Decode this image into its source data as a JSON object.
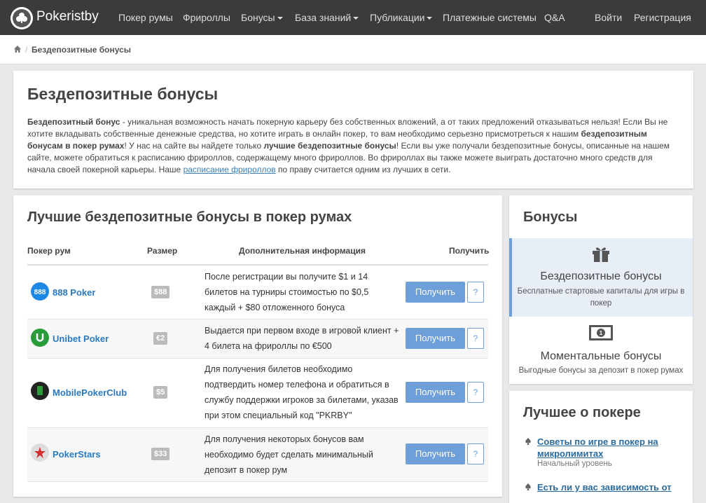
{
  "brand": {
    "name": "Pokeristby"
  },
  "nav": {
    "poker_rooms": "Покер румы",
    "freerolls": "Фрироллы",
    "bonuses": "Бонусы",
    "knowledge": "База знаний",
    "publications": "Публикации",
    "payments": "Платежные системы",
    "qa": "Q&A",
    "login": "Войти",
    "register": "Регистрация"
  },
  "breadcrumb": {
    "current": "Бездепозитные бонусы"
  },
  "intro": {
    "title": "Бездепозитные бонусы",
    "b1": "Бездепозитный бонус",
    "t1": " - уникальная возможность начать покерную карьеру без собственных вложений, а от таких предложений отказываться нельзя! Если Вы не хотите вкладывать собственные денежные средства, но хотите играть в онлайн покер, то вам необходимо серьезно присмотреться к нашим ",
    "b2": "бездепозитным бонусам в покер румах",
    "t2": "! У нас на сайте вы найдете только ",
    "b3": "лучшие бездепозитные бонусы",
    "t3": "! Если вы уже получали бездепозитные бонусы, описанные на нашем сайте, можете обратиться к расписанию фрироллов, содержащему много фрироллов. Во фрироллах вы также можете выиграть достаточно много средств для начала своей покерной карьеры. Наше ",
    "link": "расписание фрироллов",
    "t4": " по праву считается одним из лучших в сети."
  },
  "best_bonuses": {
    "title": "Лучшие бездепозитные бонусы в покер румах",
    "headers": {
      "room": "Покер рум",
      "size": "Размер",
      "info": "Дополнительная информация",
      "get": "Получить"
    },
    "get_label": "Получить",
    "help_label": "?",
    "rows": [
      {
        "name": "888 Poker",
        "size": "$88",
        "info": "После регистрации вы получите $1 и 14 билетов на турниры стоимостью по $0,5 каждый + $80 отложенного бонуса"
      },
      {
        "name": "Unibet Poker",
        "size": "€2",
        "info": "Выдается при первом входе в игровой клиент + 4 билета на фрироллы по €500"
      },
      {
        "name": "MobilePokerClub",
        "size": "$5",
        "info": "Для получения билетов необходимо подтвердить номер телефона и обратиться в службу поддержки игроков за билетами, указав при этом специальный код \"PKRBY\""
      },
      {
        "name": "PokerStars",
        "size": "$33",
        "info": "Для получения некоторых бонусов вам необходимо будет сделать минимальный депозит в покер рум"
      }
    ]
  },
  "sidebar_bonuses": {
    "title": "Бонусы",
    "items": [
      {
        "title": "Бездепозитные бонусы",
        "desc": "Бесплатные стартовые капиталы для игры в покер"
      },
      {
        "title": "Моментальные бонусы",
        "desc": "Выгодные бонусы за депозит в покер румах"
      }
    ]
  },
  "best_poker": {
    "title": "Лучшее о покере",
    "items": [
      {
        "title": "Советы по игре в покер на микролимитах",
        "level": "Начальный уровень"
      },
      {
        "title": "Есть ли у вас зависимость от"
      }
    ]
  },
  "colors": {
    "navbar": "#3b3b3b",
    "accent": "#6f9fd8",
    "link": "#2a7ac0"
  }
}
